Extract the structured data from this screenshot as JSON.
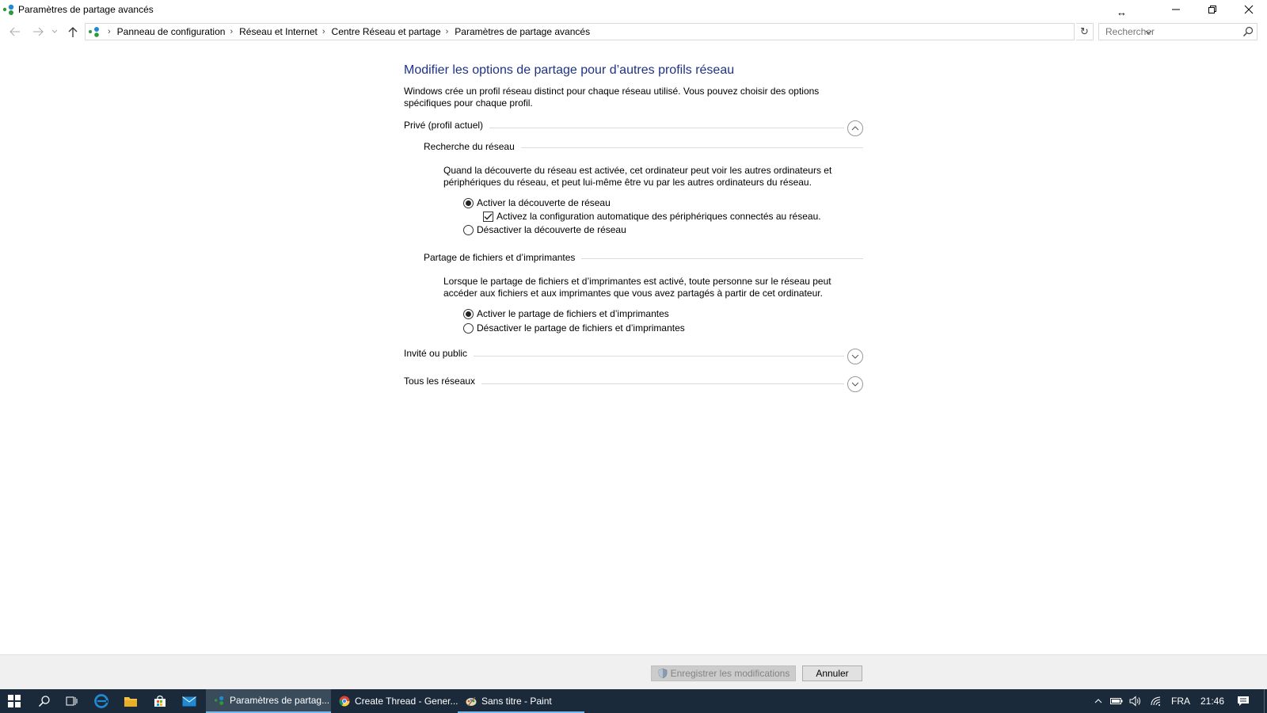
{
  "window": {
    "title": "Paramètres de partage avancés"
  },
  "address": {
    "crumbs": [
      "Panneau de configuration",
      "Réseau et Internet",
      "Centre Réseau et partage",
      "Paramètres de partage avancés"
    ],
    "search_placeholder": "Rechercher"
  },
  "page": {
    "title": "Modifier les options de partage pour d’autres profils réseau",
    "intro": "Windows crée un profil réseau distinct pour chaque réseau utilisé. Vous pouvez choisir des options spécifiques pour chaque profil."
  },
  "sections": {
    "private": {
      "label": "Privé (profil actuel)",
      "expanded": true,
      "discovery": {
        "label": "Recherche du réseau",
        "description": "Quand la découverte du réseau est activée, cet ordinateur peut voir les autres ordinateurs et périphériques du réseau, et peut lui-même être vu par les autres ordinateurs du réseau.",
        "enable_label": "Activer la découverte de réseau",
        "auto_config_label": "Activez la configuration automatique des périphériques connectés au réseau.",
        "disable_label": "Désactiver la découverte de réseau",
        "selected": "enable",
        "auto_config_checked": true
      },
      "sharing": {
        "label": "Partage de fichiers et d’imprimantes",
        "description": "Lorsque le partage de fichiers et d’imprimantes est activé, toute personne sur le réseau peut accéder aux fichiers et aux imprimantes que vous avez partagés à partir de cet ordinateur.",
        "enable_label": "Activer le partage de fichiers et d’imprimantes",
        "disable_label": "Désactiver le partage de fichiers et d’imprimantes",
        "selected": "enable"
      }
    },
    "guest": {
      "label": "Invité ou public",
      "expanded": false
    },
    "all": {
      "label": "Tous les réseaux",
      "expanded": false
    }
  },
  "actions": {
    "save_label": "Enregistrer les modifications",
    "cancel_label": "Annuler"
  },
  "taskbar": {
    "apps": [
      {
        "label": "Paramètres de partag...",
        "active": true,
        "icon": "network-icon"
      },
      {
        "label": "Create Thread - Gener...",
        "active": false,
        "icon": "chrome-icon"
      },
      {
        "label": "Sans titre - Paint",
        "active": false,
        "icon": "paint-icon"
      }
    ],
    "language": "FRA",
    "time": "21:46"
  },
  "colors": {
    "title_blue": "#1e3287",
    "taskbar": "#1b2a3a",
    "accent": "#76b9ed"
  }
}
